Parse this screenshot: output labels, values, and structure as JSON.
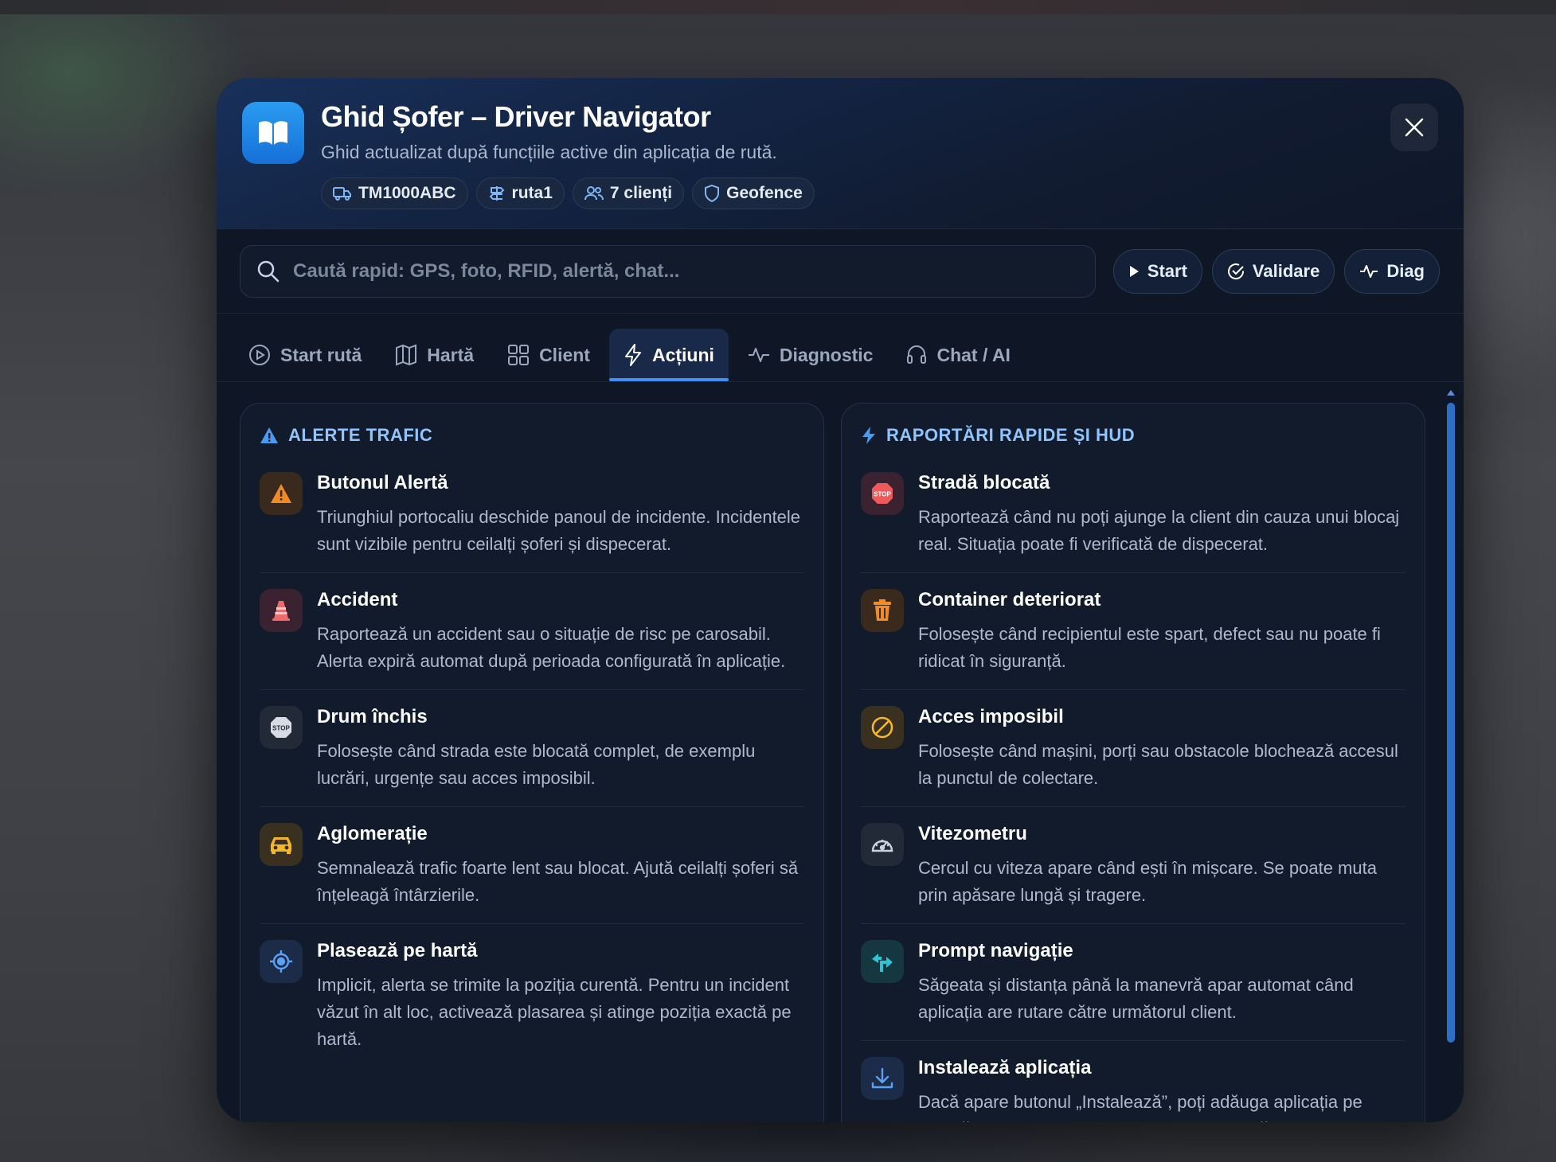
{
  "header": {
    "title": "Ghid Șofer – Driver Navigator",
    "subtitle": "Ghid actualizat după funcțiile active din aplicația de rută.",
    "chips": [
      {
        "label": "TM1000ABC",
        "icon": "truck-icon"
      },
      {
        "label": "ruta1",
        "icon": "signpost-icon"
      },
      {
        "label": "7 clienți",
        "icon": "users-icon"
      },
      {
        "label": "Geofence",
        "icon": "shield-icon"
      }
    ]
  },
  "search": {
    "placeholder": "Caută rapid: GPS, foto, RFID, alertă, chat...",
    "value": ""
  },
  "quick_buttons": [
    {
      "label": "Start",
      "icon": "play-icon"
    },
    {
      "label": "Validare",
      "icon": "check-circle-icon"
    },
    {
      "label": "Diag",
      "icon": "pulse-icon"
    }
  ],
  "tabs": [
    {
      "label": "Start rută",
      "icon": "play-circle-icon",
      "active": false
    },
    {
      "label": "Hartă",
      "icon": "map-icon",
      "active": false
    },
    {
      "label": "Client",
      "icon": "grid-icon",
      "active": false
    },
    {
      "label": "Acțiuni",
      "icon": "bolt-icon",
      "active": true
    },
    {
      "label": "Diagnostic",
      "icon": "pulse-icon",
      "active": false
    },
    {
      "label": "Chat / AI",
      "icon": "headset-icon",
      "active": false
    }
  ],
  "left_panel": {
    "title": "ALERTE TRAFIC",
    "items": [
      {
        "title": "Butonul Alertă",
        "desc": "Triunghiul portocaliu deschide panoul de incidente. Incidentele sunt vizibile pentru ceilalți șoferi și dispecerat.",
        "icon": "warning-icon"
      },
      {
        "title": "Accident",
        "desc": "Raportează un accident sau o situație de risc pe carosabil. Alerta expiră automat după perioada configurată în aplicație.",
        "icon": "traffic-cone-icon"
      },
      {
        "title": "Drum închis",
        "desc": "Folosește când strada este blocată complet, de exemplu lucrări, urgențe sau acces imposibil.",
        "icon": "stop-sign-icon"
      },
      {
        "title": "Aglomerație",
        "desc": "Semnalează trafic foarte lent sau blocat. Ajută ceilalți șoferi să înțeleagă întârzierile.",
        "icon": "car-icon"
      },
      {
        "title": "Plasează pe hartă",
        "desc": "Implicit, alerta se trimite la poziția curentă. Pentru un incident văzut în alt loc, activează plasarea și atinge poziția exactă pe hartă.",
        "icon": "target-icon"
      }
    ]
  },
  "right_panel": {
    "title": "RAPORTĂRI RAPIDE ȘI HUD",
    "items": [
      {
        "title": "Stradă blocată",
        "desc": "Raportează când nu poți ajunge la client din cauza unui blocaj real. Situația poate fi verificată de dispecerat.",
        "icon": "stop-sign-icon"
      },
      {
        "title": "Container deteriorat",
        "desc": "Folosește când recipientul este spart, defect sau nu poate fi ridicat în siguranță.",
        "icon": "trash-icon"
      },
      {
        "title": "Acces imposibil",
        "desc": "Folosește când mașini, porți sau obstacole blochează accesul la punctul de colectare.",
        "icon": "forbidden-icon"
      },
      {
        "title": "Vitezometru",
        "desc": "Cercul cu viteza apare când ești în mișcare. Se poate muta prin apăsare lungă și tragere.",
        "icon": "speedometer-icon"
      },
      {
        "title": "Prompt navigație",
        "desc": "Săgeata și distanța până la manevră apar automat când aplicația are rutare către următorul client.",
        "icon": "turn-arrow-icon"
      },
      {
        "title": "Instalează aplicația",
        "desc": "Dacă apare butonul „Instalează”, poți adăuga aplicația pe tabletă ca PWA pentru deschidere mai rapidă și aspect",
        "icon": "download-icon"
      }
    ]
  },
  "colors": {
    "accent": "#3d8ff0",
    "modal_bg": "#0f1726",
    "panel_title": "#8fc4ff",
    "warning": "#f28b26"
  }
}
